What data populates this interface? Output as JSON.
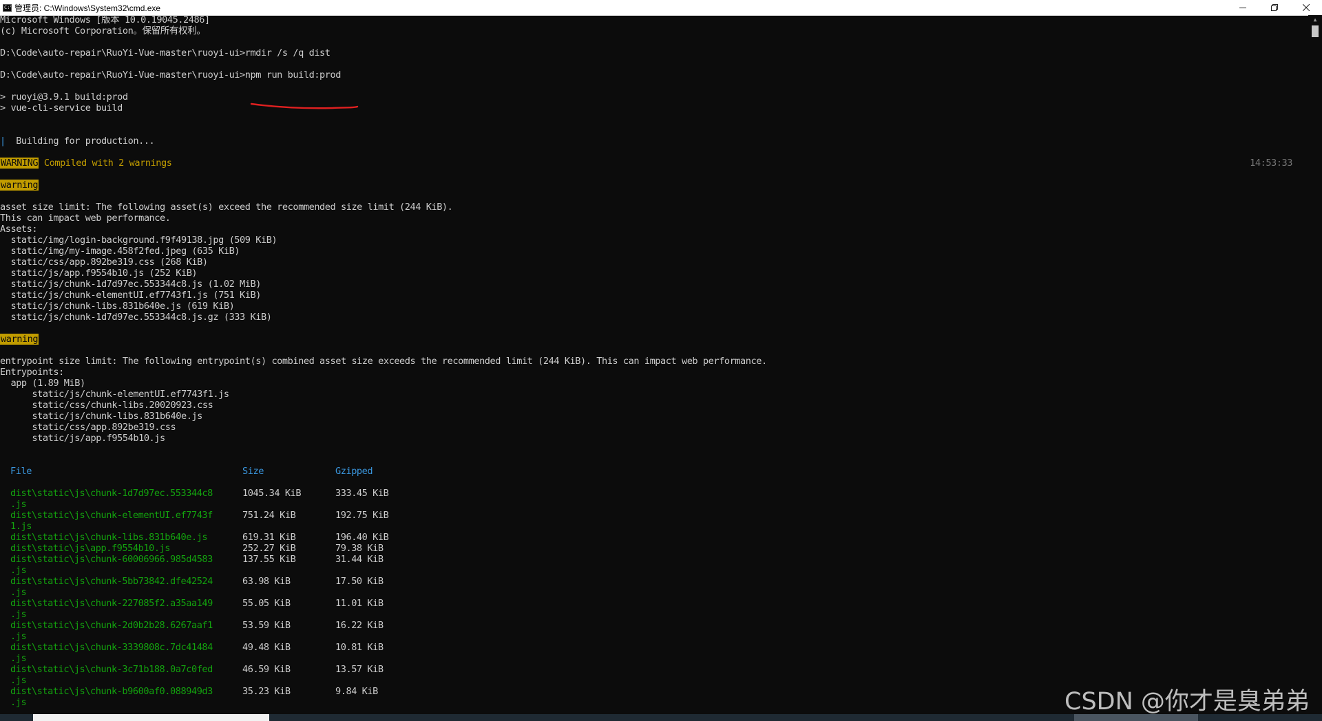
{
  "window": {
    "title": "管理员: C:\\Windows\\System32\\cmd.exe",
    "icon": "cmd-icon",
    "controls": [
      "minimize-icon",
      "restore-icon",
      "close-icon"
    ]
  },
  "console": {
    "lines": [
      "Microsoft Windows [版本 10.0.19045.2486]",
      "(c) Microsoft Corporation。保留所有权利。",
      "D:\\Code\\auto-repair\\RuoYi-Vue-master\\ruoyi-ui>rmdir /s /q dist",
      "D:\\Code\\auto-repair\\RuoYi-Vue-master\\ruoyi-ui>npm run build:prod",
      "> ruoyi@3.9.1 build:prod",
      "> vue-cli-service build",
      "Building for production...",
      "asset size limit: The following asset(s) exceed the recommended size limit (244 KiB).",
      "This can impact web performance.",
      "Assets:",
      "  static/img/login-background.f9f49138.jpg (509 KiB)",
      "  static/img/my-image.458f2fed.jpeg (635 KiB)",
      "  static/css/app.892be319.css (268 KiB)",
      "  static/js/app.f9554b10.js (252 KiB)",
      "  static/js/chunk-1d7d97ec.553344c8.js (1.02 MiB)",
      "  static/js/chunk-elementUI.ef7743f1.js (751 KiB)",
      "  static/js/chunk-libs.831b640e.js (619 KiB)",
      "  static/js/chunk-1d7d97ec.553344c8.js.gz (333 KiB)",
      "entrypoint size limit: The following entrypoint(s) combined asset size exceeds the recommended limit (244 KiB). This can impact web performance.",
      "Entrypoints:",
      "  app (1.89 MiB)",
      "      static/js/chunk-elementUI.ef7743f1.js",
      "      static/css/chunk-libs.20020923.css",
      "      static/js/chunk-libs.831b640e.js",
      "      static/css/app.892be319.css",
      "      static/js/app.f9554b10.js"
    ],
    "build_marker": "|",
    "warning_badge": "WARNING",
    "warning_summary": "Compiled with 2 warnings",
    "timestamp": "14:53:33",
    "warning_label": "warning"
  },
  "table": {
    "headers": [
      "File",
      "Size",
      "Gzipped"
    ],
    "rows": [
      {
        "file": "dist\\static\\js\\chunk-1d7d97ec.553344c8",
        "file2": ".js",
        "size": "1045.34 KiB",
        "gz": "333.45 KiB"
      },
      {
        "file": "dist\\static\\js\\chunk-elementUI.ef7743f",
        "file2": "1.js",
        "size": "751.24 KiB",
        "gz": "192.75 KiB"
      },
      {
        "file": "dist\\static\\js\\chunk-libs.831b640e.js",
        "file2": "",
        "size": "619.31 KiB",
        "gz": "196.40 KiB"
      },
      {
        "file": "dist\\static\\js\\app.f9554b10.js",
        "file2": "",
        "size": "252.27 KiB",
        "gz": "79.38 KiB"
      },
      {
        "file": "dist\\static\\js\\chunk-60006966.985d4583",
        "file2": ".js",
        "size": "137.55 KiB",
        "gz": "31.44 KiB"
      },
      {
        "file": "dist\\static\\js\\chunk-5bb73842.dfe42524",
        "file2": ".js",
        "size": "63.98 KiB",
        "gz": "17.50 KiB"
      },
      {
        "file": "dist\\static\\js\\chunk-227085f2.a35aa149",
        "file2": ".js",
        "size": "55.05 KiB",
        "gz": "11.01 KiB"
      },
      {
        "file": "dist\\static\\js\\chunk-2d0b2b28.6267aaf1",
        "file2": ".js",
        "size": "53.59 KiB",
        "gz": "16.22 KiB"
      },
      {
        "file": "dist\\static\\js\\chunk-3339808c.7dc41484",
        "file2": ".js",
        "size": "49.48 KiB",
        "gz": "10.81 KiB"
      },
      {
        "file": "dist\\static\\js\\chunk-3c71b188.0a7c0fed",
        "file2": ".js",
        "size": "46.59 KiB",
        "gz": "13.57 KiB"
      },
      {
        "file": "dist\\static\\js\\chunk-b9600af0.088949d3",
        "file2": ".js",
        "size": "35.23 KiB",
        "gz": "9.84 KiB"
      }
    ]
  },
  "watermark": "CSDN @你才是臭弟弟",
  "colors": {
    "background": "#0c0c0c",
    "text": "#cccccc",
    "warning": "#c19c00",
    "header": "#3a96dd",
    "file": "#13a10e",
    "annotation": "#e02020"
  }
}
